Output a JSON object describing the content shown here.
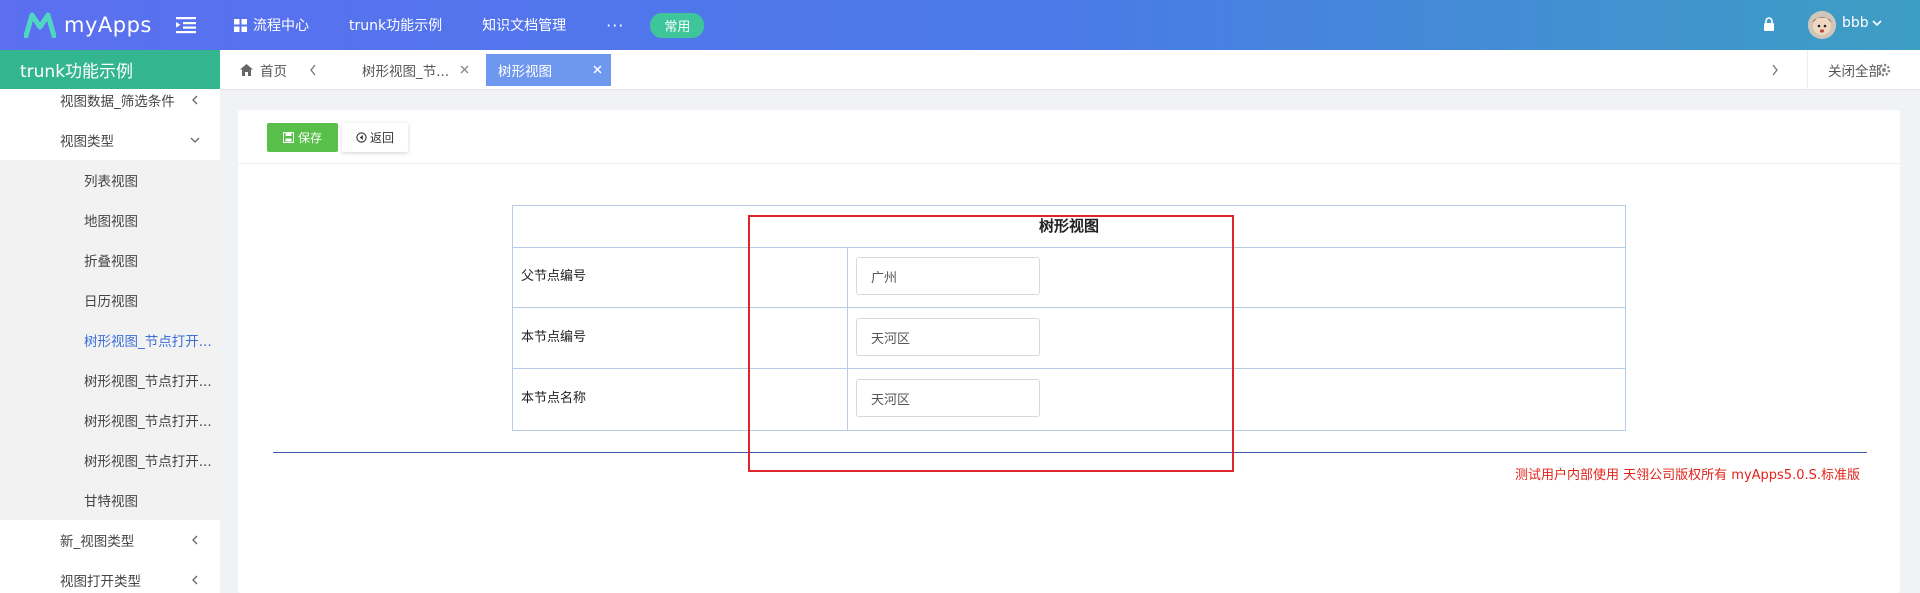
{
  "app": {
    "name": "myApps"
  },
  "topnav": {
    "items": [
      "流程中心",
      "trunk功能示例",
      "知识文档管理"
    ],
    "more": "···",
    "pill": "常用"
  },
  "user": {
    "name": "bbb"
  },
  "sidebar": {
    "title": "trunk功能示例",
    "items": [
      {
        "label": "视图数据_筛选条件"
      },
      {
        "label": "视图类型"
      },
      {
        "label": "列表视图"
      },
      {
        "label": "地图视图"
      },
      {
        "label": "折叠视图"
      },
      {
        "label": "日历视图"
      },
      {
        "label": "树形视图_节点打开..."
      },
      {
        "label": "树形视图_节点打开..."
      },
      {
        "label": "树形视图_节点打开..."
      },
      {
        "label": "树形视图_节点打开..."
      },
      {
        "label": "甘特视图"
      },
      {
        "label": "新_视图类型"
      },
      {
        "label": "视图打开类型"
      }
    ]
  },
  "tabs": {
    "home": "首页",
    "items": [
      {
        "label": "树形视图_节..."
      },
      {
        "label": "树形视图"
      }
    ],
    "close_all": "关闭全部"
  },
  "toolbar": {
    "save": "保存",
    "back": "返回"
  },
  "form": {
    "title": "树形视图",
    "rows": [
      {
        "label": "父节点编号",
        "value": "广州"
      },
      {
        "label": "本节点编号",
        "value": "天河区"
      },
      {
        "label": "本节点名称",
        "value": "天河区"
      }
    ]
  },
  "footer": {
    "copyright": "测试用户内部使用 天翎公司版权所有 myApps5.0.S.标准版"
  },
  "colors": {
    "topbar_start": "#5b6ff0",
    "topbar_end": "#3d9ec3",
    "sidebar_header": "#33b58f",
    "active_tab": "#6e97f0",
    "save_button": "#58bf4a",
    "pill": "#3ec69a",
    "annotation_box": "#e0262b",
    "copyright": "#e2231a"
  }
}
